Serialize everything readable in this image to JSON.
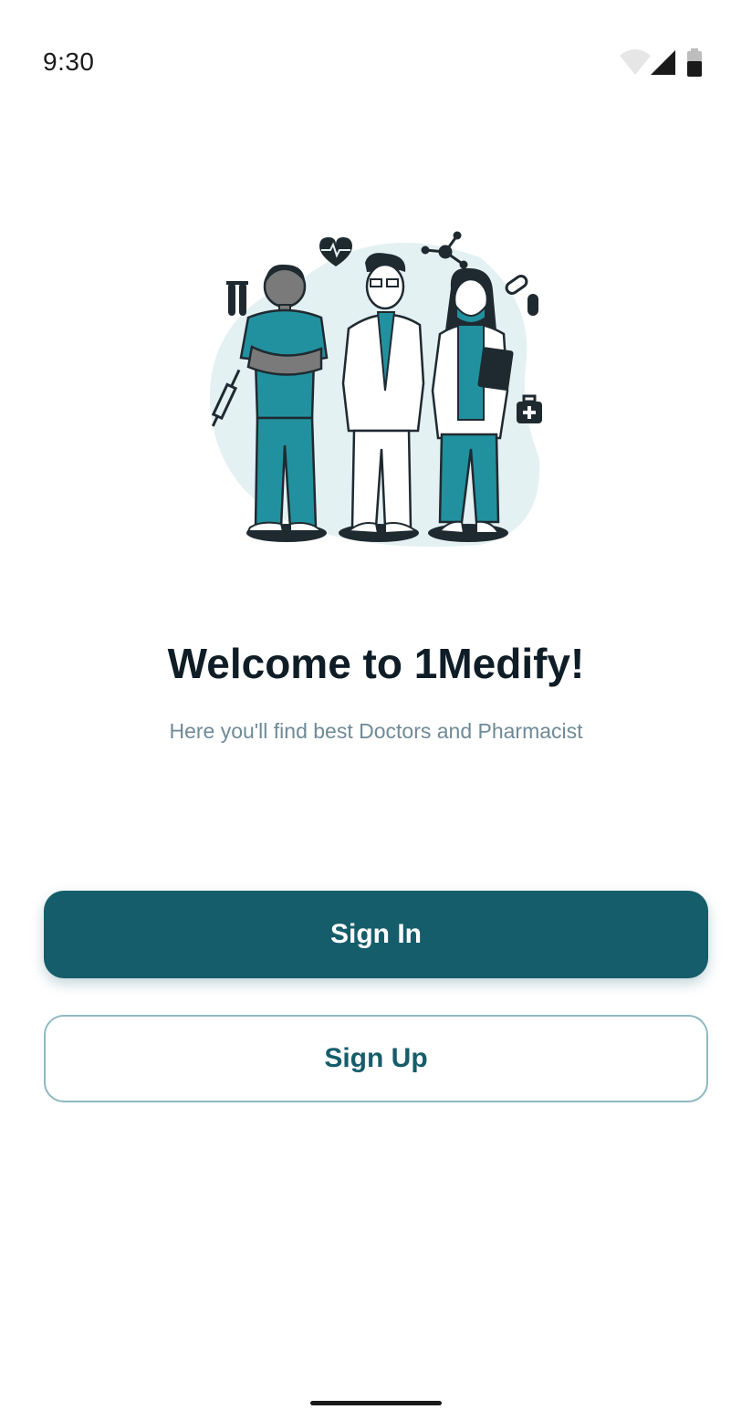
{
  "status_bar": {
    "time": "9:30",
    "icons": [
      "wifi-icon",
      "signal-icon",
      "battery-icon"
    ]
  },
  "illustration": {
    "name": "medical-team-illustration",
    "blob_color": "#e4f1f3",
    "accent_color": "#22919f",
    "ink_color": "#1f2a30"
  },
  "welcome": {
    "title": "Welcome to 1Medify!",
    "subtitle": "Here you'll find best Doctors and Pharmacist"
  },
  "actions": {
    "sign_in_label": "Sign In",
    "sign_up_label": "Sign Up"
  },
  "colors": {
    "primary": "#155d6a",
    "title": "#0f1d26",
    "subtitle": "#6f8a96",
    "outline": "#8fb8c0"
  }
}
